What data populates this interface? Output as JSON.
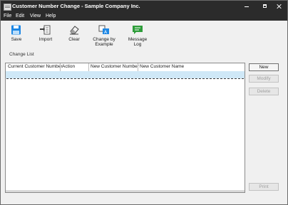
{
  "window": {
    "title": "Customer Number Change - Sample Company Inc."
  },
  "menu": {
    "items": [
      "File",
      "Edit",
      "View",
      "Help"
    ]
  },
  "toolbar": {
    "save_label": "Save",
    "import_label": "Import",
    "clear_label": "Clear",
    "change_by_example_label_1": "Change by",
    "change_by_example_label_2": "Example",
    "message_log_label_1": "Message",
    "message_log_label_2": "Log"
  },
  "change_list": {
    "section_label": "Change List",
    "columns": [
      "Current Customer Number",
      "Action",
      "New Customer Number",
      "New Customer Name"
    ],
    "rows": []
  },
  "side_buttons": {
    "new_label": "New",
    "modify_label": "Modify",
    "delete_label": "Delete",
    "print_label": "Print"
  },
  "colors": {
    "titlebar": "#2b2b2b",
    "selected_row": "#cfe8f7",
    "save_icon": "#1e88e5",
    "message_icon": "#2e9d3a"
  }
}
